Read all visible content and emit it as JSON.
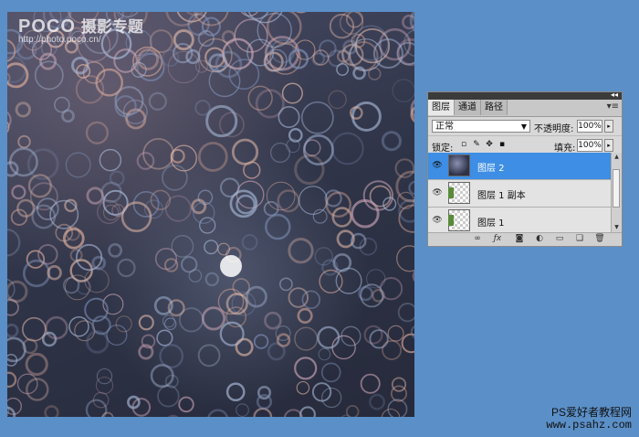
{
  "watermark": {
    "logo": "POCO",
    "subtitle": "摄影专题",
    "url": "http://photo.poco.cn/"
  },
  "layers_panel": {
    "tabs": [
      "图层",
      "通道",
      "路径"
    ],
    "active_tab": 0,
    "blend_mode": "正常",
    "opacity_label": "不透明度:",
    "opacity_value": "100%",
    "lock_label": "锁定:",
    "fill_label": "填充:",
    "fill_value": "100%",
    "layers": [
      {
        "name": "图层 2",
        "thumb": "bokeh",
        "selected": true
      },
      {
        "name": "图层 1 副本",
        "thumb": "checker-mask",
        "selected": false
      },
      {
        "name": "图层 1",
        "thumb": "checker-mask",
        "selected": false
      }
    ],
    "icons": [
      "link-icon",
      "fx-icon",
      "mask-icon",
      "adjustment-icon",
      "group-icon",
      "new-layer-icon",
      "trash-icon"
    ]
  },
  "footer": {
    "line1": "PS爱好者教程网",
    "line2": "www.psahz.com"
  },
  "colors": {
    "background": "#5b8fc7",
    "selection": "#3d8ee4"
  }
}
